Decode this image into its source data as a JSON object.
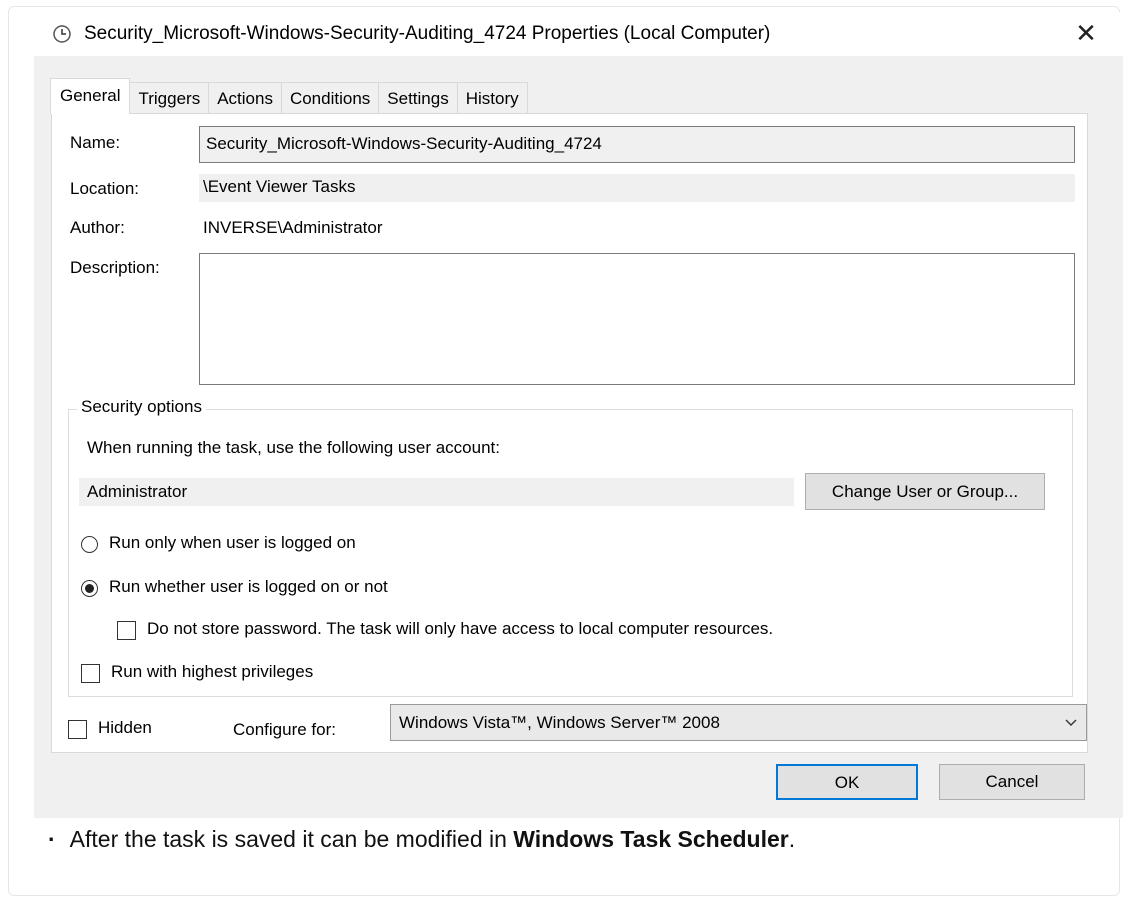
{
  "window": {
    "title": "Security_Microsoft-Windows-Security-Auditing_4724 Properties (Local Computer)",
    "title_icon": "clock-icon",
    "close_glyph": "✕"
  },
  "tabs": [
    {
      "label": "General",
      "active": true
    },
    {
      "label": "Triggers",
      "active": false
    },
    {
      "label": "Actions",
      "active": false
    },
    {
      "label": "Conditions",
      "active": false
    },
    {
      "label": "Settings",
      "active": false
    },
    {
      "label": "History",
      "active": false
    }
  ],
  "general": {
    "name_label": "Name:",
    "name_value": "Security_Microsoft-Windows-Security-Auditing_4724",
    "location_label": "Location:",
    "location_value": "\\Event Viewer Tasks",
    "author_label": "Author:",
    "author_value": "INVERSE\\Administrator",
    "description_label": "Description:",
    "description_value": ""
  },
  "security": {
    "legend": "Security options",
    "account_prompt": "When running the task, use the following user account:",
    "account_value": "Administrator",
    "change_button": "Change User or Group...",
    "radio_logged_on": "Run only when user is logged on",
    "radio_logged_on_checked": false,
    "radio_whether": "Run whether user is logged on or not",
    "radio_whether_checked": true,
    "no_store_password": "Do not store password.  The task will only have access to local computer resources.",
    "no_store_password_checked": false,
    "highest_privileges": "Run with highest privileges",
    "highest_privileges_checked": false
  },
  "footer": {
    "hidden_label": "Hidden",
    "hidden_checked": false,
    "configure_label": "Configure for:",
    "configure_value": "Windows Vista™, Windows Server™ 2008",
    "ok_button": "OK",
    "cancel_button": "Cancel"
  },
  "note": {
    "bullet": "·",
    "text_before": "After the task is saved it can be modified in ",
    "text_bold": "Windows Task Scheduler",
    "text_after": "."
  },
  "colors": {
    "dialog_bg": "#f0f0f0",
    "focus_border": "#0078d7",
    "button_bg": "#e1e1e1"
  }
}
